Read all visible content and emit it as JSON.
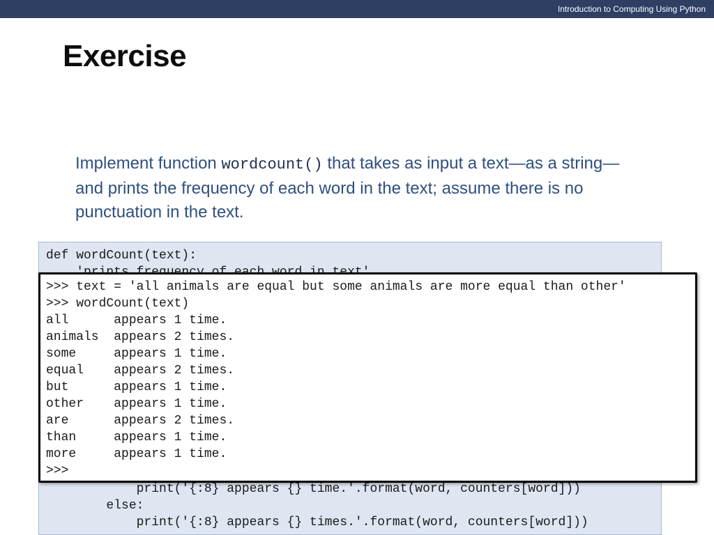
{
  "header": {
    "course_title": "Introduction to Computing Using Python"
  },
  "slide": {
    "title": "Exercise"
  },
  "prompt": {
    "text_before": "Implement function ",
    "function_name": "wordcount()",
    "text_after": " that takes as input a text—as a string— and prints the frequency of each word in the text; assume there is no punctuation in the text."
  },
  "code": {
    "visible_lines": [
      "def wordCount(text):",
      "    'prints frequency of each word in text'",
      "            print('{:8} appears {} time.'.format(word, counters[word]))",
      "        else:",
      "            print('{:8} appears {} times.'.format(word, counters[word]))"
    ]
  },
  "shell": {
    "lines": [
      ">>> text = 'all animals are equal but some animals are more equal than other'",
      ">>> wordCount(text)",
      "all      appears 1 time.",
      "animals  appears 2 times.",
      "some     appears 1 time.",
      "equal    appears 2 times.",
      "but      appears 1 time.",
      "other    appears 1 time.",
      "are      appears 2 times.",
      "than     appears 1 time.",
      "more     appears 1 time.",
      ">>>"
    ]
  }
}
